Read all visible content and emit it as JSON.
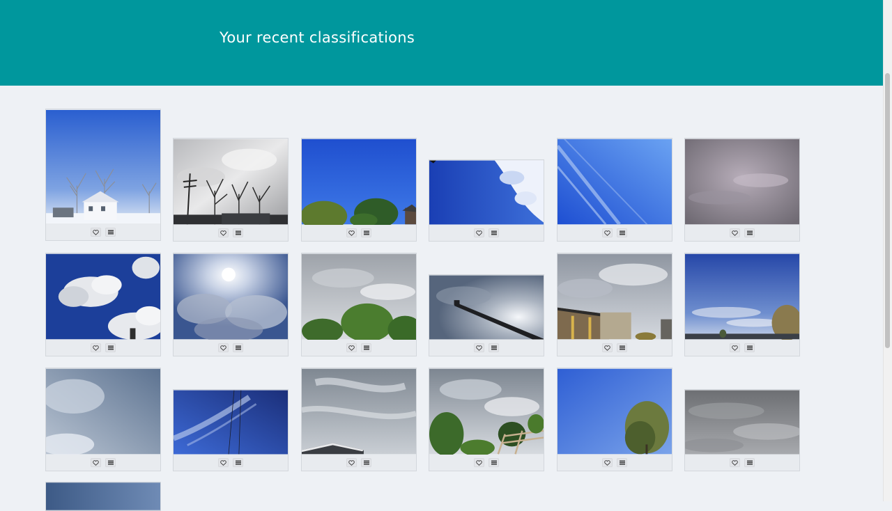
{
  "header": {
    "title": "Your recent classifications"
  },
  "icons": {
    "favorite": "heart-icon",
    "collect": "list-icon"
  },
  "colors": {
    "header_bg": "#00979d",
    "page_bg": "#eef1f5"
  },
  "classifications": [
    {
      "subject": "snowy trees and house under blue sky",
      "sky": "clear"
    },
    {
      "subject": "bare trees and power pole under grey clouds",
      "sky": "overcast"
    },
    {
      "subject": "deep blue sky above green trees",
      "sky": "clear"
    },
    {
      "subject": "blue sky with patchy white clouds",
      "sky": "partly-cloudy"
    },
    {
      "subject": "blue sky with thin contrails",
      "sky": "clear"
    },
    {
      "subject": "uniform purple-grey overcast",
      "sky": "overcast"
    },
    {
      "subject": "puffy cumulus clouds in blue sky",
      "sky": "partly-cloudy"
    },
    {
      "subject": "sun behind bright cumulus clouds",
      "sky": "partly-cloudy"
    },
    {
      "subject": "grey cloudy sky over trees",
      "sky": "overcast"
    },
    {
      "subject": "street light against hazy sky",
      "sky": "partly-cloudy"
    },
    {
      "subject": "house roofline under grey clouds",
      "sky": "overcast"
    },
    {
      "subject": "blue sky with thin clouds over field",
      "sky": "partly-cloudy"
    },
    {
      "subject": "hazy pale blue sky",
      "sky": "hazy"
    },
    {
      "subject": "blue sky with wispy cirrus and wires",
      "sky": "clear"
    },
    {
      "subject": "grey streaky clouds over roof",
      "sky": "overcast"
    },
    {
      "subject": "cloudy sky over trees and trellis",
      "sky": "overcast"
    },
    {
      "subject": "clear blue sky with tree",
      "sky": "clear"
    },
    {
      "subject": "dark grey overcast",
      "sky": "overcast"
    },
    {
      "subject": "blue-grey sky",
      "sky": "hazy"
    }
  ]
}
